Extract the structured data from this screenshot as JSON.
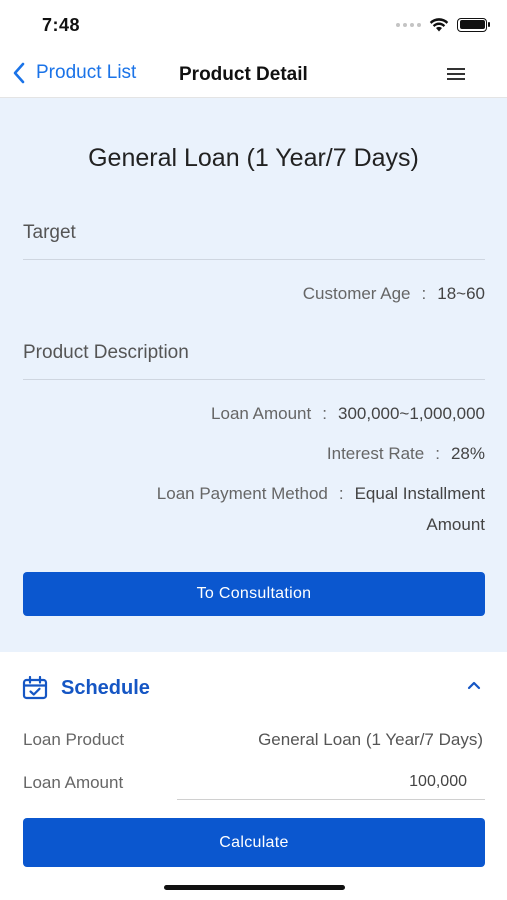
{
  "status_bar": {
    "time": "7:48"
  },
  "nav": {
    "back_label": "Product List",
    "title": "Product Detail"
  },
  "product": {
    "title": "General Loan (1 Year/7 Days)",
    "target_section": "Target",
    "customer_age_label": "Customer Age",
    "customer_age_value": "18~60",
    "description_section": "Product Description",
    "loan_amount_label": "Loan Amount",
    "loan_amount_value": "300,000~1,000,000",
    "interest_rate_label": "Interest Rate",
    "interest_rate_value": "28%",
    "payment_method_label": "Loan Payment Method",
    "payment_method_value_line1": "Equal Installment",
    "payment_method_value_line2": "Amount",
    "separator": ":",
    "consult_button": "To Consultation"
  },
  "schedule": {
    "title": "Schedule",
    "loan_product_label": "Loan Product",
    "loan_product_value": "General Loan (1 Year/7 Days)",
    "loan_amount_label": "Loan Amount",
    "loan_amount_value": "100,000",
    "calculate_button": "Calculate"
  },
  "icons": {
    "back": "chevron-left-icon",
    "menu": "hamburger-menu-icon",
    "schedule": "calendar-check-icon",
    "collapse": "chevron-up-icon"
  },
  "colors": {
    "accent": "#1a73e8",
    "button": "#0b57cf",
    "panel": "#eaf2fc",
    "schedule_title": "#1556c4"
  }
}
